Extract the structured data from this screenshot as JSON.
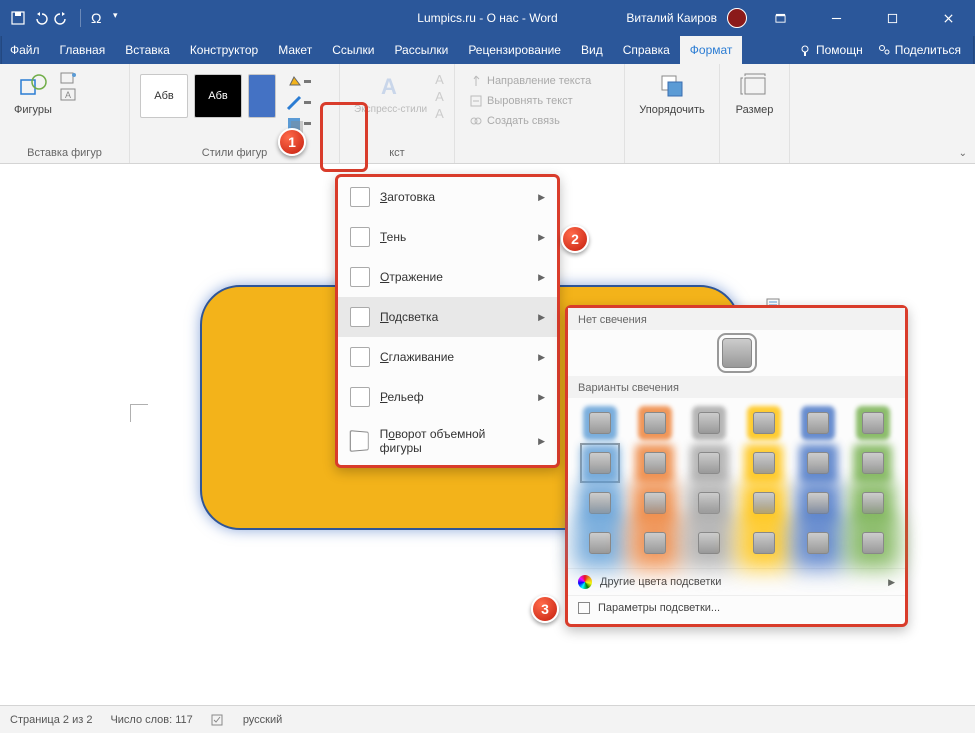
{
  "title": "Lumpics.ru - О нас  -  Word",
  "user": "Виталий Каиров",
  "tabs": [
    "Файл",
    "Главная",
    "Вставка",
    "Конструктор",
    "Макет",
    "Ссылки",
    "Рассылки",
    "Рецензирование",
    "Вид",
    "Справка",
    "Формат"
  ],
  "tabs_right": {
    "help": "Помощн",
    "share": "Поделиться"
  },
  "ribbon": {
    "group_insert": {
      "label": "Вставка фигур",
      "btn": "Фигуры"
    },
    "group_styles": {
      "label": "Стили фигур",
      "swatch": "Абв"
    },
    "group_wordart": {
      "label": "кст",
      "express": "Экспресс-стили"
    },
    "group_text": {
      "dir": "Направление текста",
      "align": "Выровнять текст",
      "link": "Создать связь"
    },
    "group_arrange": {
      "btn": "Упорядочить"
    },
    "group_size": {
      "btn": "Размер"
    }
  },
  "effects_menu": [
    {
      "label": "Заготовка",
      "u": "З"
    },
    {
      "label": "Тень",
      "u": "Т"
    },
    {
      "label": "Отражение",
      "u": "О"
    },
    {
      "label": "Подсветка",
      "u": "П",
      "hover": true
    },
    {
      "label": "Сглаживание",
      "u": "С"
    },
    {
      "label": "Рельеф",
      "u": "Р"
    },
    {
      "label": "Поворот объемной фигуры",
      "u": "о",
      "rot": true
    }
  ],
  "glow_menu": {
    "no_glow": "Нет свечения",
    "variants": "Варианты свечения",
    "more_colors": "Другие цвета подсветки",
    "options": "Параметры подсветки...",
    "colors": [
      "#5b9bd5",
      "#ed7d31",
      "#a5a5a5",
      "#ffc000",
      "#4472c4",
      "#70ad47"
    ]
  },
  "status": {
    "page": "Страница 2 из 2",
    "words": "Число слов: 117",
    "lang": "русский"
  },
  "markers": [
    "1",
    "2",
    "3"
  ]
}
